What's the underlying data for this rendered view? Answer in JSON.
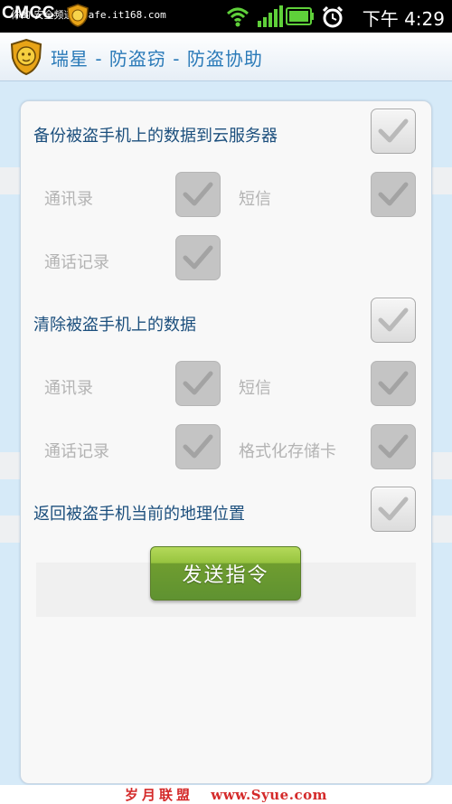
{
  "status_bar": {
    "carrier": "CMCC",
    "watermark": "你的 安全频道",
    "watermark_url": "safe.it168.com",
    "time": "下午 4:29",
    "icons": [
      "logo-badge-icon",
      "wifi-icon",
      "signal-icon",
      "battery-icon",
      "alarm-clock-icon"
    ]
  },
  "title_bar": {
    "title": "瑞星 - 防盗窃 - 防盗协助",
    "logo_icon": "lion-shield-logo-icon"
  },
  "form": {
    "section_backup": {
      "label": "备份被盗手机上的数据到云服务器",
      "checked": true,
      "enabled": true,
      "options": [
        {
          "label": "通讯录",
          "checked": true,
          "enabled": false
        },
        {
          "label": "短信",
          "checked": true,
          "enabled": false
        },
        {
          "label": "通话记录",
          "checked": true,
          "enabled": false
        }
      ]
    },
    "section_wipe": {
      "label": "清除被盗手机上的数据",
      "checked": true,
      "enabled": true,
      "options": [
        {
          "label": "通讯录",
          "checked": true,
          "enabled": false
        },
        {
          "label": "短信",
          "checked": true,
          "enabled": false
        },
        {
          "label": "通话记录",
          "checked": true,
          "enabled": false
        },
        {
          "label": "格式化存储卡",
          "checked": true,
          "enabled": false
        }
      ]
    },
    "section_locate": {
      "label": "返回被盗手机当前的地理位置",
      "checked": true,
      "enabled": true
    },
    "send_button_label": "发送指令"
  },
  "footer": {
    "watermark": "岁月联盟",
    "watermark_url": "www.Syue.com"
  },
  "colors": {
    "title_text": "#2a7ab8",
    "section_label": "#1c4f7d",
    "disabled_label": "#b3b3b3",
    "button_green": "#6f9d2f",
    "watermark_red": "#d42a2a",
    "background_blue": "#d6eaf8"
  }
}
